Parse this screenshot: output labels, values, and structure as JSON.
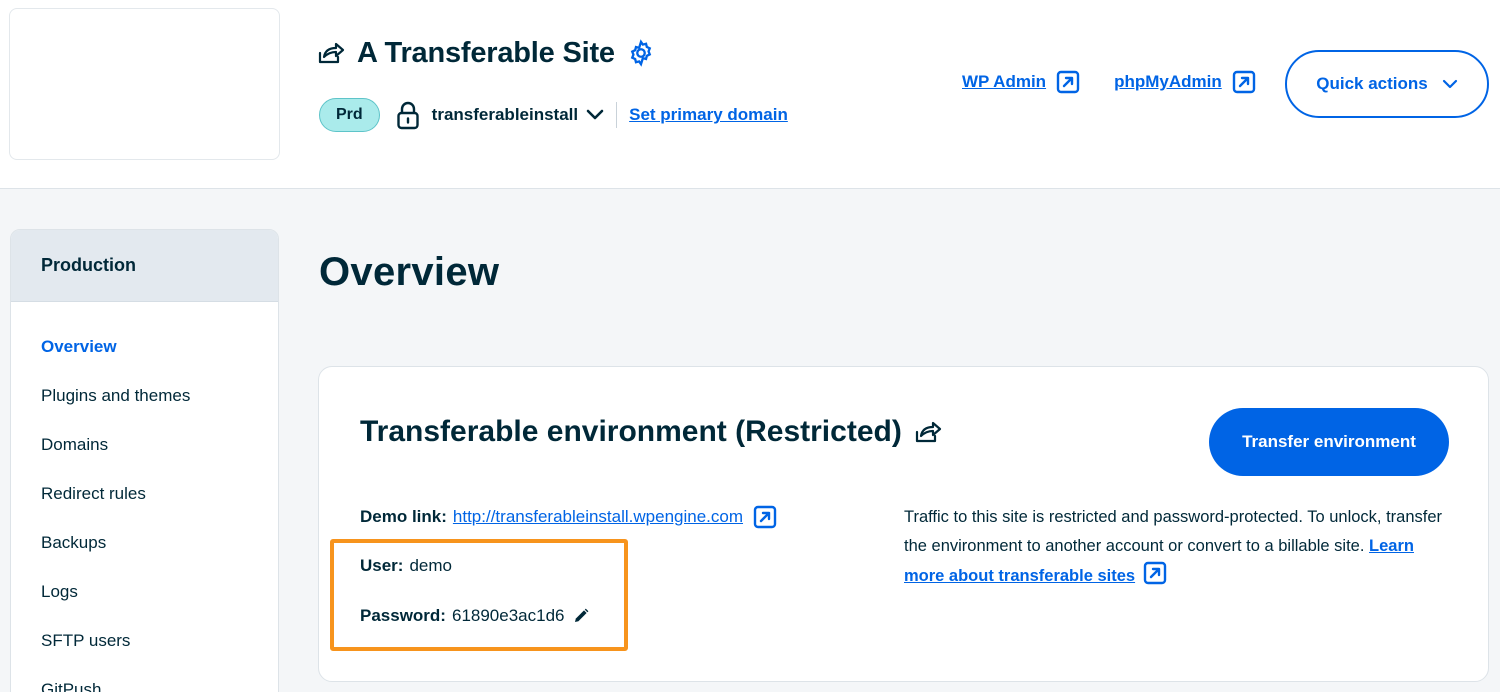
{
  "header": {
    "site_title": "A Transferable Site",
    "env_badge": "Prd",
    "install_name": "transferableinstall",
    "set_primary_domain": "Set primary domain",
    "wp_admin": "WP Admin",
    "phpmyadmin": "phpMyAdmin",
    "quick_actions": "Quick actions"
  },
  "sidebar": {
    "heading": "Production",
    "items": [
      {
        "label": "Overview",
        "active": true
      },
      {
        "label": "Plugins and themes"
      },
      {
        "label": "Domains"
      },
      {
        "label": "Redirect rules"
      },
      {
        "label": "Backups"
      },
      {
        "label": "Logs"
      },
      {
        "label": "SFTP users"
      },
      {
        "label": "GitPush"
      }
    ]
  },
  "main": {
    "title": "Overview",
    "card": {
      "title": "Transferable environment (Restricted)",
      "transfer_button": "Transfer environment",
      "demo_link_label": "Demo link:",
      "demo_link_url": "http://transferableinstall.wpengine.com",
      "user_label": "User:",
      "user_value": "demo",
      "password_label": "Password:",
      "password_value": "61890e3ac1d6",
      "description": "Traffic to this site is restricted and password-protected. To unlock, transfer the environment to another account or convert to a billable site.",
      "learn_more": "Learn more about transferable sites"
    }
  },
  "icons": {
    "share": "share-arrow-icon",
    "settings": "gear-icon",
    "lock": "lock-icon",
    "dropdown": "chevron-down-icon",
    "external": "external-link-icon",
    "edit": "pencil-icon"
  },
  "colors": {
    "brand_blue": "#0064e5",
    "text_dark": "#002838",
    "badge_bg": "#aaebeb",
    "highlight_orange": "#f7941d",
    "page_bg": "#f4f6f8"
  }
}
